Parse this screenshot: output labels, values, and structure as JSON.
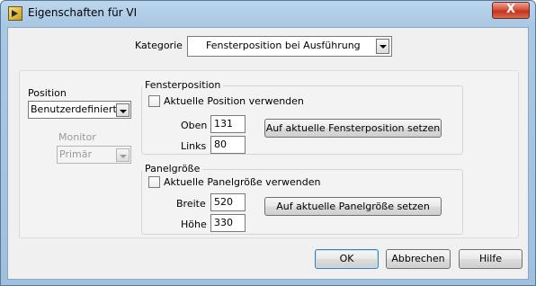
{
  "window": {
    "title": "Eigenschaften für VI",
    "close_label": "X"
  },
  "category": {
    "label": "Kategorie",
    "value": "Fensterposition bei Ausführung"
  },
  "position": {
    "label": "Position",
    "value": "Benutzerdefiniert"
  },
  "monitor": {
    "label": "Monitor",
    "value": "Primär"
  },
  "window_position": {
    "title": "Fensterposition",
    "use_current_label": "Aktuelle Position verwenden",
    "top_label": "Oben",
    "top_value": "131",
    "left_label": "Links",
    "left_value": "80",
    "set_button": "Auf aktuelle Fensterposition setzen"
  },
  "panel_size": {
    "title": "Panelgröße",
    "use_current_label": "Aktuelle Panelgröße verwenden",
    "width_label": "Breite",
    "width_value": "520",
    "height_label": "Höhe",
    "height_value": "330",
    "set_button": "Auf aktuelle Panelgröße setzen"
  },
  "buttons": {
    "ok": "OK",
    "cancel": "Abbrechen",
    "help": "Hilfe"
  }
}
